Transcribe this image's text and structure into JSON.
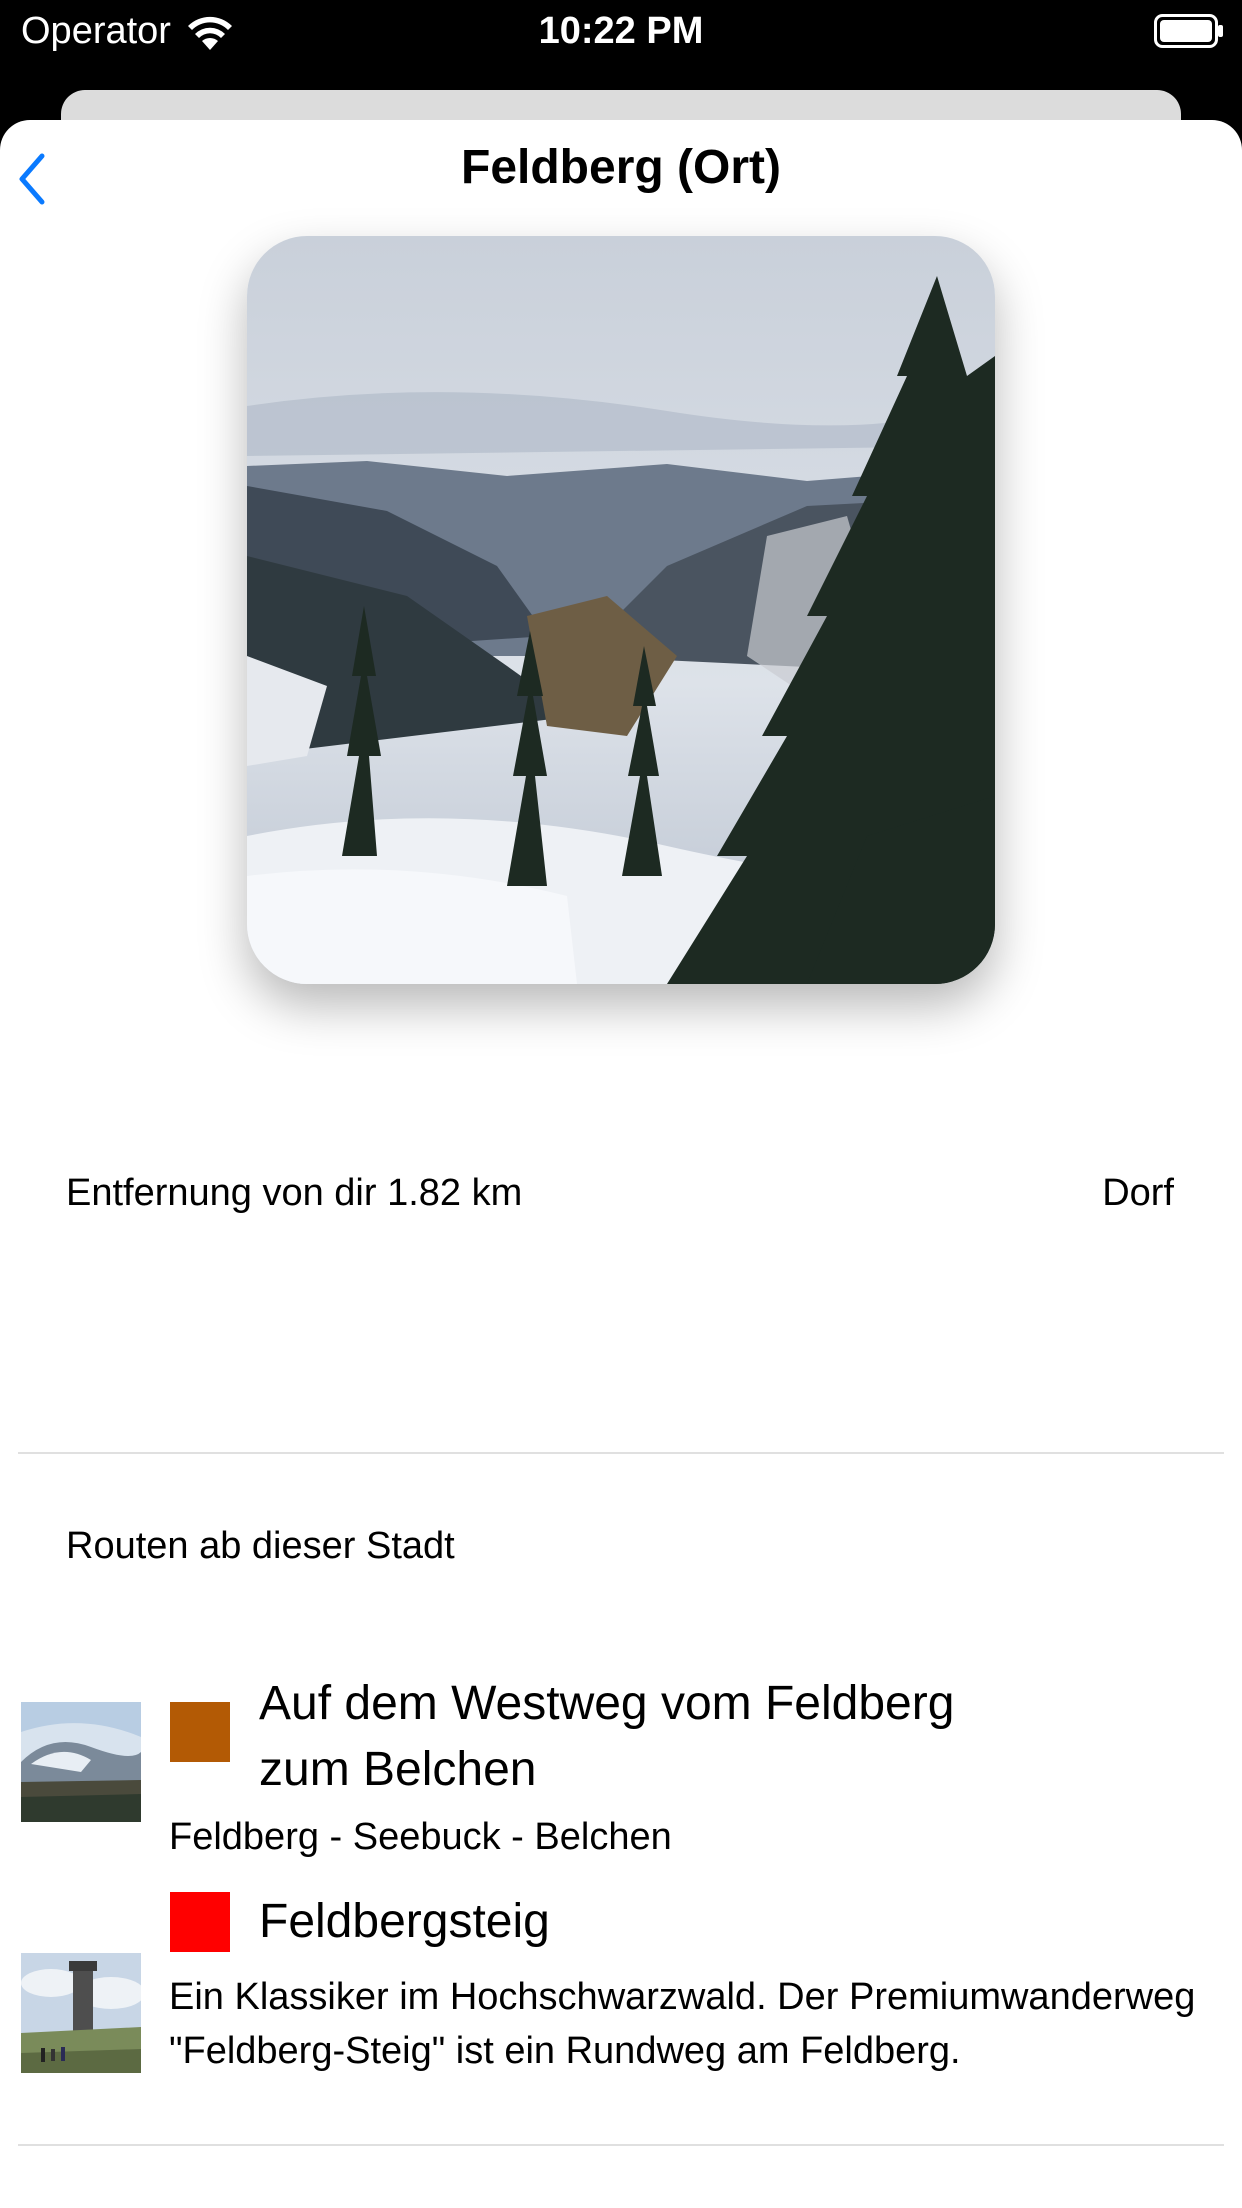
{
  "status_bar": {
    "carrier": "Operator",
    "time": "10:22 PM"
  },
  "nav": {
    "title": "Feldberg (Ort)"
  },
  "info": {
    "distance": "Entfernung von dir 1.82 km",
    "type": "Dorf"
  },
  "routes_section": {
    "title": "Routen ab dieser Stadt",
    "routes": [
      {
        "title_line1": "Auf dem Westweg vom Feldberg",
        "title_line2": "zum Belchen",
        "description": "Feldberg - Seebuck - Belchen",
        "color": "#B35A05"
      },
      {
        "title_line1": "Feldbergsteig",
        "description": "Ein Klassiker im Hochschwarzwald. Der Premiumwanderweg \"Feldberg-Steig\" ist ein Rundweg am Feldberg.",
        "color": "#FF0000"
      }
    ]
  },
  "colors": {
    "accent": "#0A7AFF",
    "divider": "#E0E0E0"
  }
}
